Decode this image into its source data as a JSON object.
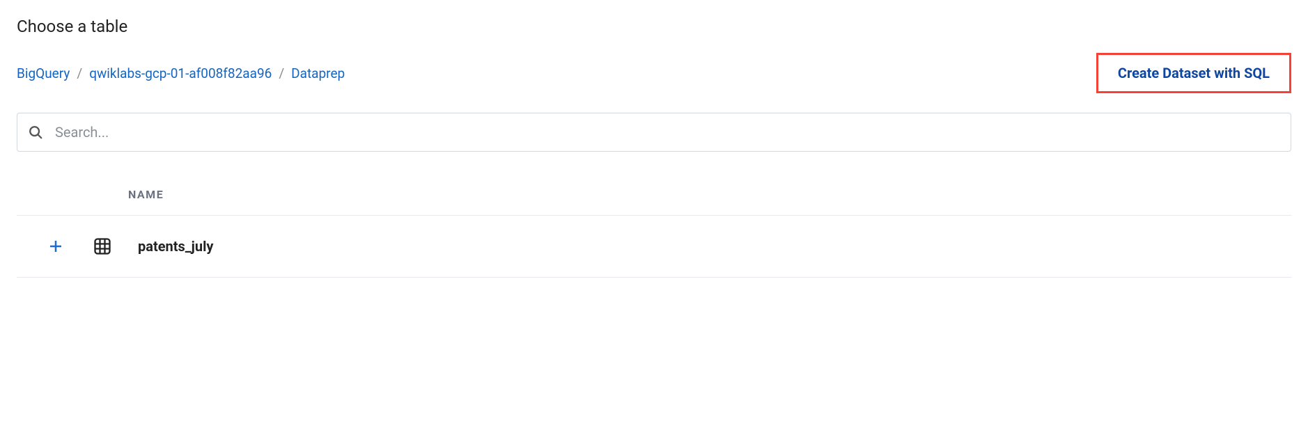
{
  "title": "Choose a table",
  "breadcrumb": {
    "items": [
      {
        "label": "BigQuery"
      },
      {
        "label": "qwiklabs-gcp-01-af008f82aa96"
      }
    ],
    "current": "Dataprep",
    "separator": "/"
  },
  "actions": {
    "create_sql": "Create Dataset with SQL"
  },
  "search": {
    "placeholder": "Search...",
    "value": ""
  },
  "table": {
    "columns": {
      "name": "NAME"
    },
    "rows": [
      {
        "name": "patents_july"
      }
    ]
  }
}
